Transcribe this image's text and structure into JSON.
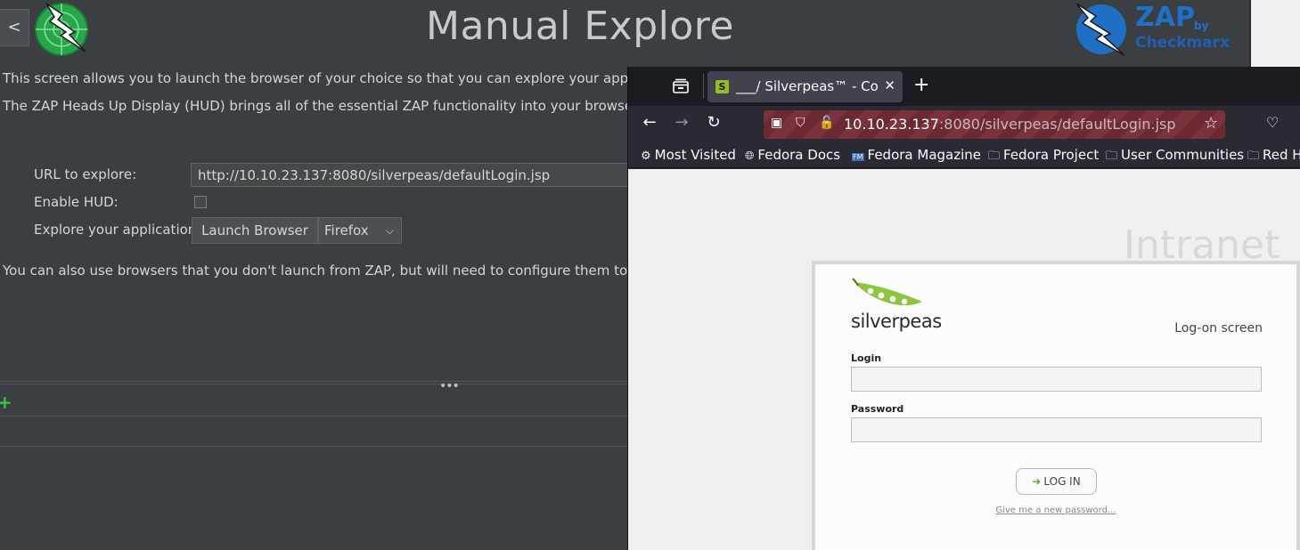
{
  "zap": {
    "back_label": "<",
    "title": "Manual Explore",
    "brand": {
      "name": "ZAP",
      "by": "by",
      "vendor": "Checkmarx"
    },
    "description_1": "This screen allows you to launch the browser of your choice so that you can explore your application w",
    "description_2": "The ZAP Heads Up Display (HUD) brings all of the essential ZAP functionality into your browser.",
    "url_label": "URL to explore:",
    "url_value": "http://10.10.23.137:8080/silverpeas/defaultLogin.jsp",
    "hud_label": "Enable HUD:",
    "hud_enabled": false,
    "explore_label": "Explore your application:",
    "launch_button": "Launch Browser",
    "browser_selected": "Firefox",
    "note": "You can also use browsers that you don't launch from ZAP, but will need to configure them to proxy th",
    "grip": "•••",
    "add_icon": "+"
  },
  "firefox": {
    "tab_title": "___/ Silverpeas™ - Collab",
    "tab_favicon_letter": "S",
    "url_host": "10.10.23.137",
    "url_rest": ":8080/silverpeas/defaultLogin.jsp",
    "bookmarks": [
      {
        "icon": "gear-icon",
        "label": "Most Visited"
      },
      {
        "icon": "globe-icon",
        "label": "Fedora Docs"
      },
      {
        "icon": "fm-icon",
        "label": "Fedora Magazine"
      },
      {
        "icon": "folder-icon",
        "label": "Fedora Project"
      },
      {
        "icon": "folder-icon",
        "label": "User Communities"
      },
      {
        "icon": "folder-icon",
        "label": "Red H"
      }
    ]
  },
  "page": {
    "intranet": "Intranet",
    "logo_word": "silverpeas",
    "logon_label": "Log-on screen",
    "login_label": "Login",
    "password_label": "Password",
    "login_button": "LOG IN",
    "forgot_link": "Give me a new password..."
  },
  "colors": {
    "zap_bg": "#3c3f41",
    "firefox_bg": "#2b2a33",
    "accent_green": "#8fbf24",
    "zap_blue": "#1f70c8"
  }
}
